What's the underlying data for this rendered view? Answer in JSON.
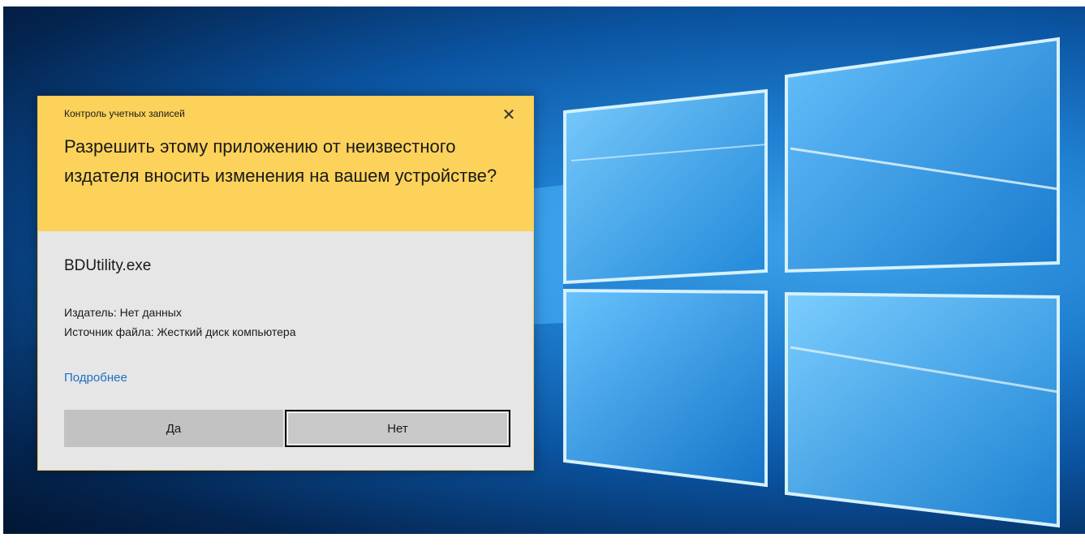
{
  "dialog": {
    "caption": "Контроль учетных записей",
    "close_glyph": "✕",
    "question": "Разрешить этому приложению от неизвестного издателя вносить изменения на вашем устройстве?",
    "app_name": "BDUtility.exe",
    "publisher": "Издатель: Нет данных",
    "source": "Источник файла: Жесткий диск компьютера",
    "details_link": "Подробнее",
    "yes_label": "Да",
    "no_label": "Нет"
  },
  "colors": {
    "header_yellow": "#fcd25a",
    "dialog_body": "#e6e6e6",
    "link_blue": "#1f6fc5",
    "wallpaper_blue": "#1f7fd1"
  },
  "icons": {
    "close": "close-icon"
  }
}
